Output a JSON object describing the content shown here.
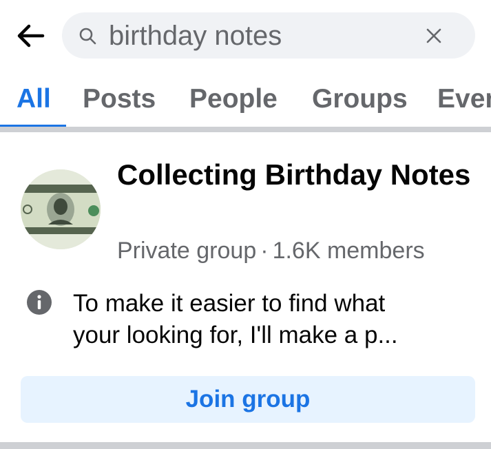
{
  "search": {
    "query": "birthday notes",
    "back_icon": "arrow-left-icon",
    "search_icon": "magnifier-icon",
    "clear_icon": "close-icon"
  },
  "tabs": [
    {
      "label": "All",
      "active": true
    },
    {
      "label": "Posts",
      "active": false
    },
    {
      "label": "People",
      "active": false
    },
    {
      "label": "Groups",
      "active": false
    },
    {
      "label": "Even",
      "active": false
    }
  ],
  "result": {
    "title": "Collecting Birthday Notes",
    "privacy": "Private group",
    "separator": "·",
    "members": "1.6K members",
    "snippet_line1": "To make it easier to find what",
    "snippet_line2": "your looking for, I'll make a p...",
    "avatar_icon": "dollar-bill-image",
    "info_icon": "info-icon",
    "join_label": "Join group"
  },
  "colors": {
    "accent": "#1b74e4",
    "secondary_text": "#65676b",
    "search_bg": "#f0f2f5",
    "join_bg": "#e7f3ff",
    "divider": "#ced0d4"
  }
}
